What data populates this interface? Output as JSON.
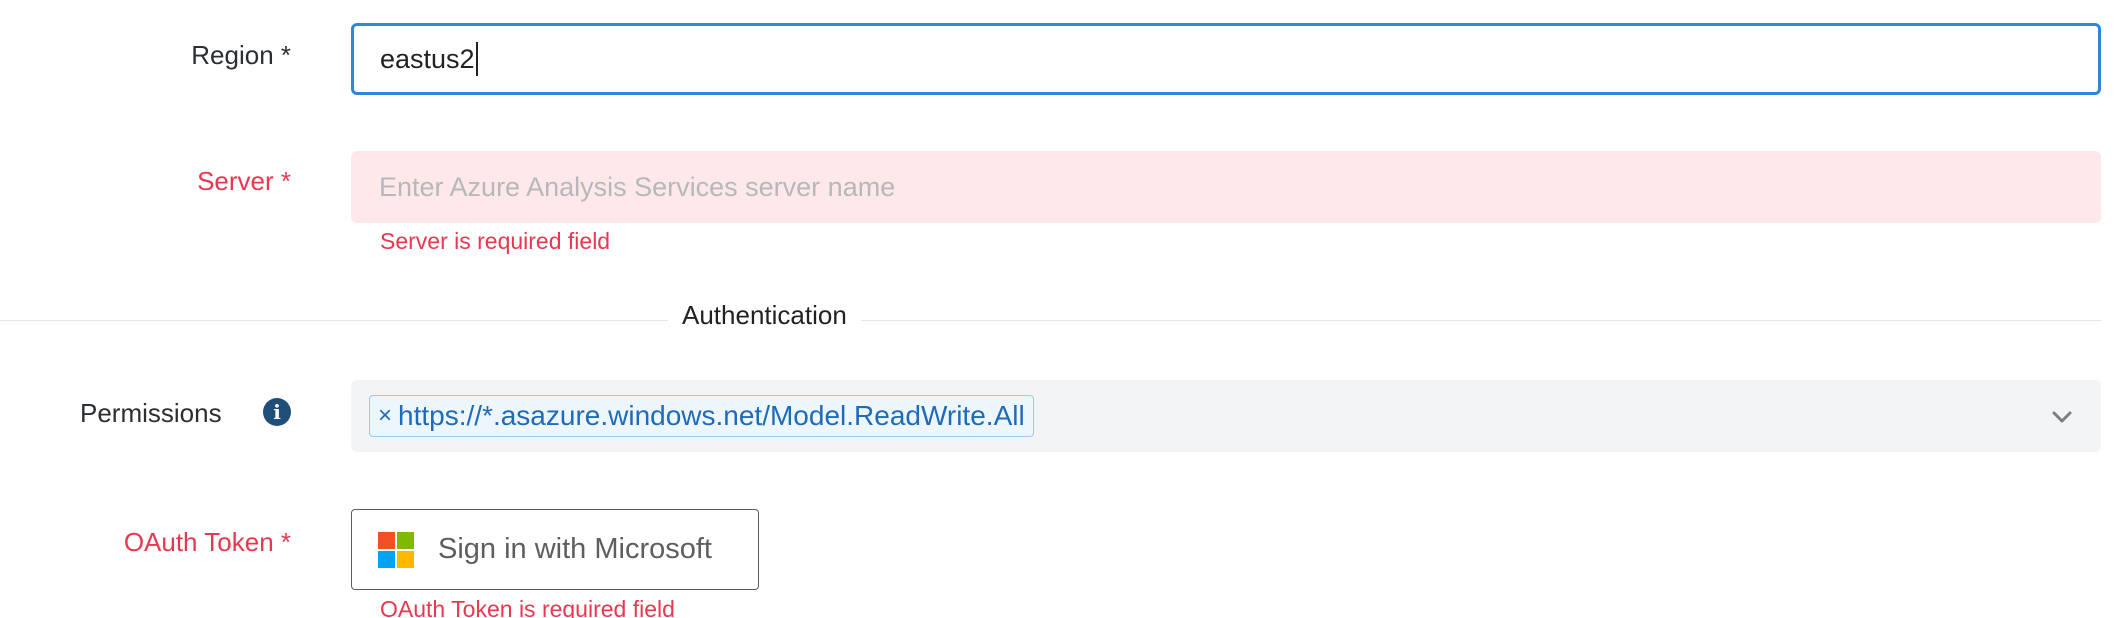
{
  "region": {
    "label": "Region *",
    "value": "eastus2"
  },
  "server": {
    "label": "Server *",
    "placeholder": "Enter Azure Analysis Services server name",
    "error": "Server is required field"
  },
  "authentication": {
    "section_title": "Authentication"
  },
  "permissions": {
    "label": "Permissions",
    "info_icon": "info-circle-icon",
    "selected": [
      {
        "remove": "×",
        "value": "https://*.asazure.windows.net/Model.ReadWrite.All"
      }
    ],
    "dropdown_icon": "chevron-down-icon"
  },
  "oauth": {
    "label": "OAuth Token *",
    "button_label": "Sign in with Microsoft",
    "logo_icon": "microsoft-logo-icon",
    "error": "OAuth Token is required field"
  },
  "colors": {
    "focus_border": "#2f87d8",
    "error": "#e8384f",
    "error_bg": "#ffe8e9",
    "tag_text": "#1e6bb8",
    "ms_red": "#f25022",
    "ms_green": "#7fba00",
    "ms_blue": "#00a4ef",
    "ms_yellow": "#ffb900"
  }
}
